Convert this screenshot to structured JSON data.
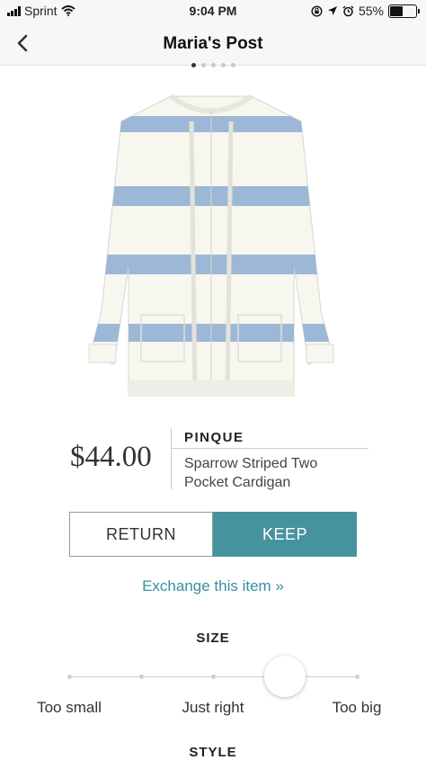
{
  "status_bar": {
    "carrier": "Sprint",
    "time": "9:04 PM",
    "battery": "55%",
    "battery_level": 0.55,
    "icons": [
      "signal-icon",
      "wifi-icon",
      "screen-lock-icon",
      "location-icon",
      "alarm-icon",
      "battery-icon"
    ]
  },
  "nav": {
    "title": "Maria's Post",
    "back_icon": "chevron-left-icon"
  },
  "carousel": {
    "dot_count": 5,
    "active_index": 0
  },
  "product": {
    "brand": "PINQUE",
    "name": "Sparrow Striped Two Pocket Cardigan",
    "price": "$44.00",
    "image": "striped-cardigan-image",
    "colors": {
      "body": "#f7f6ef",
      "stripe": "#9db8d6"
    }
  },
  "actions": {
    "return_label": "RETURN",
    "keep_label": "KEEP",
    "keep_color": "#46939e",
    "exchange_link": "Exchange this item »"
  },
  "size_feedback": {
    "title": "SIZE",
    "options": [
      "Too small",
      "Just right",
      "Too big"
    ],
    "selected_position": 0.75
  },
  "style_section": {
    "title": "STYLE"
  }
}
